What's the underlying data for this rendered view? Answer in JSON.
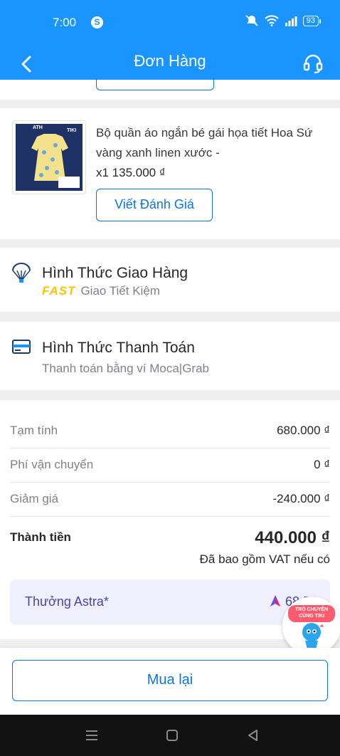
{
  "status_bar": {
    "time": "7:00",
    "skype_letter": "S",
    "battery": "93"
  },
  "header": {
    "title": "Đơn Hàng"
  },
  "product": {
    "name": "Bộ quần áo ngắn bé gái họa tiết Hoa Sứ vàng xanh linen xước -",
    "qty_price": "x1  135.000 ₫",
    "review_label": "Viết Đánh Giá",
    "thumb_brand": "ATH",
    "thumb_store": "TIKI"
  },
  "shipping": {
    "title": "Hình Thức Giao Hàng",
    "badge": "FAST",
    "method": "Giao Tiết Kiệm"
  },
  "payment": {
    "title": "Hình Thức Thanh Toán",
    "method": "Thanh toán bằng ví Moca|Grab"
  },
  "summary": {
    "rows": [
      {
        "label": "Tạm tính",
        "value": "680.000 ₫"
      },
      {
        "label": "Phí vận chuyển",
        "value": "0 ₫"
      },
      {
        "label": "Giảm giá",
        "value": "-240.000 ₫"
      }
    ],
    "total_label": "Thành tiền",
    "total_value": "440.000 ₫",
    "vat_note": "Đã bao gồm VAT nếu có",
    "astra_label": "Thưởng Astra*",
    "astra_value": "68.51"
  },
  "chat": {
    "badge": "TRÒ CHUYỆN CÙNG TIKI"
  },
  "bottom": {
    "buy_again_label": "Mua lại"
  },
  "colors": {
    "primary": "#1a94ff",
    "link": "#0b74e5",
    "fast": "#ffc400",
    "astra": "#4945a8"
  }
}
